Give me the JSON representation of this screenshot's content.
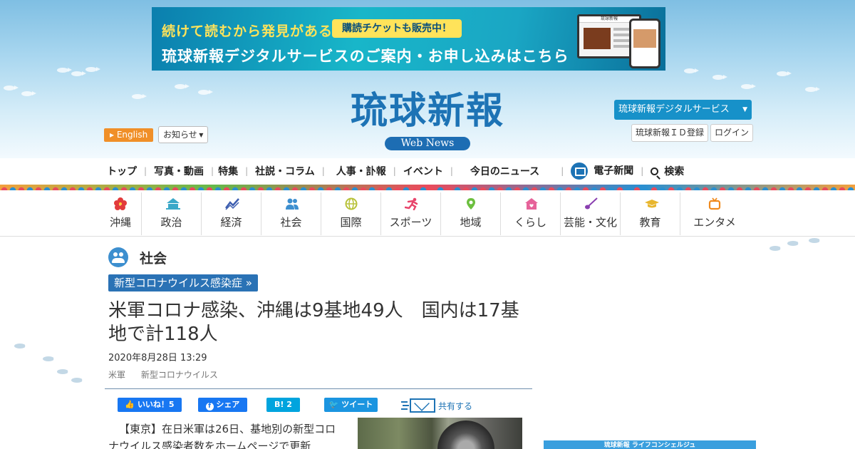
{
  "banner": {
    "line1": "続けて読むから発見がある",
    "badge": "購読チケットも販売中！",
    "line2": "琉球新報デジタルサービスのご案内・お申し込みはこちら",
    "screen_logo": "琉球新報"
  },
  "header": {
    "logo_text": "琉球新報",
    "logo_sub": "Web News",
    "english_label": "English",
    "notice_label": "お知らせ",
    "digital_service_label": "琉球新報デジタルサービス",
    "id_register_label": "琉球新報ＩＤ登録",
    "login_label": "ログイン"
  },
  "main_nav": [
    {
      "label": "トップ"
    },
    {
      "label": "写真・動画"
    },
    {
      "label": "特集"
    },
    {
      "label": "社説・コラム"
    },
    {
      "label": "人事・訃報"
    },
    {
      "label": "イベント"
    },
    {
      "label": "今日のニュース"
    },
    {
      "label": "電子新聞"
    },
    {
      "label": "検索"
    }
  ],
  "categories": [
    {
      "label": "沖縄",
      "icon": "hibiscus-icon",
      "color": "#e23b3b"
    },
    {
      "label": "政治",
      "icon": "government-building-icon",
      "color": "#3aa8c8"
    },
    {
      "label": "経済",
      "icon": "line-chart-icon",
      "color": "#3e5fb0"
    },
    {
      "label": "社会",
      "icon": "people-icon",
      "color": "#3d8fcf"
    },
    {
      "label": "国際",
      "icon": "globe-icon",
      "color": "#b8c23a"
    },
    {
      "label": "スポーツ",
      "icon": "runner-icon",
      "color": "#e8456b"
    },
    {
      "label": "地域",
      "icon": "map-pin-icon",
      "color": "#6cbf3f"
    },
    {
      "label": "くらし",
      "icon": "house-icon",
      "color": "#e6639a"
    },
    {
      "label": "芸能・文化",
      "icon": "sanshin-icon",
      "color": "#8a3fb0"
    },
    {
      "label": "教育",
      "icon": "graduation-cap-icon",
      "color": "#e8b62e"
    },
    {
      "label": "エンタメ",
      "icon": "tv-icon",
      "color": "#f08a1d"
    }
  ],
  "article": {
    "section": "社会",
    "tag": "新型コロナウイルス感染症 »",
    "headline": "米軍コロナ感染、沖縄は9基地49人　国内は17基地で計118人",
    "date": "2020年8月28日 13:29",
    "keywords": [
      "米軍",
      "新型コロナウイルス"
    ],
    "body": "【東京】在日米軍は26日、基地別の新型コロナウイルス感染者数をホームページで更新"
  },
  "share": {
    "facebook_like": "いいね！5",
    "facebook_share": "シェア",
    "hatena_count": "2",
    "tweet": "ツイート",
    "mail_share": "共有する"
  },
  "sidebar_ad": {
    "text": "琉球新報 ライフコンシェルジュ"
  },
  "colors": {
    "brand_blue": "#1d73b5",
    "accent_orange": "#f08f28",
    "tag_blue": "#2a72b5"
  }
}
